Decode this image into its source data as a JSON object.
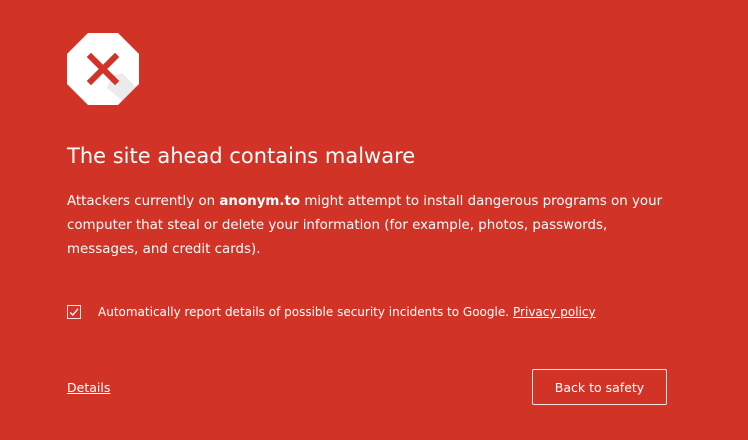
{
  "colors": {
    "background": "#d13427",
    "text": "#ffffff",
    "icon_fill": "#ffffff",
    "icon_cross": "#d13427"
  },
  "icon": {
    "name": "malware-stop-icon"
  },
  "title": "The site ahead contains malware",
  "body": {
    "prefix": "Attackers currently on ",
    "site": "anonym.to",
    "suffix": " might attempt to install dangerous programs on your computer that steal or delete your information (for example, photos, passwords, messages, and credit cards)."
  },
  "report": {
    "checked": true,
    "label": "Automatically report details of possible security incidents to Google.",
    "privacy_link": "Privacy policy"
  },
  "details_link": "Details",
  "back_button": "Back to safety"
}
